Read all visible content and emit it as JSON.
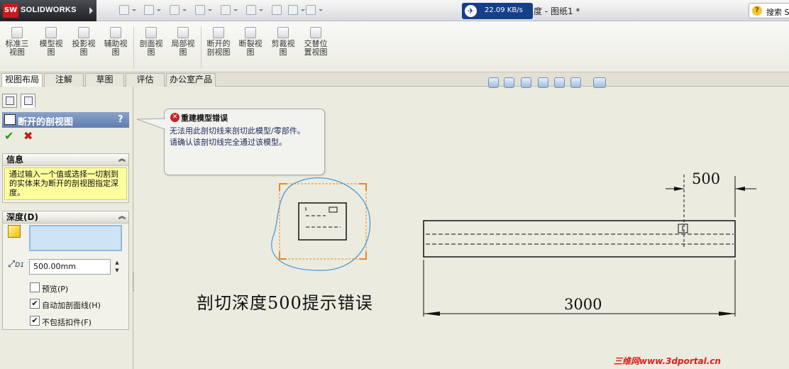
{
  "titlebar": {
    "brand": "SOLIDWORKS",
    "logo_mark": "SW",
    "net_speed": "22.09 KB/s",
    "document_title": "度 - 图纸1 *",
    "search_label": "搜索 S"
  },
  "ribbon": {
    "buttons": [
      {
        "label": "标准三\n视图",
        "icon": "standard-three-view-icon"
      },
      {
        "label": "模型视\n图",
        "icon": "model-view-icon"
      },
      {
        "label": "投影视\n图",
        "icon": "projected-view-icon"
      },
      {
        "label": "辅助视\n图",
        "icon": "auxiliary-view-icon"
      },
      {
        "label": "剖面视\n图",
        "icon": "section-view-icon"
      },
      {
        "label": "局部视\n图",
        "icon": "detail-view-icon"
      },
      {
        "label": "断开的\n剖视图",
        "icon": "broken-out-section-icon"
      },
      {
        "label": "断裂视\n图",
        "icon": "break-view-icon"
      },
      {
        "label": "剪裁视\n图",
        "icon": "crop-view-icon"
      },
      {
        "label": "交替位\n置视图",
        "icon": "alternate-position-view-icon"
      }
    ]
  },
  "tabs": [
    "视图布局",
    "注解",
    "草图",
    "评估",
    "办公室产品"
  ],
  "panel": {
    "title": "断开的剖视图",
    "help": "?",
    "info_header": "信息",
    "info_text": "通过输入一个值或选择一切割到的实体来为断开的剖视图指定深度。",
    "depth_header": "深度(D)",
    "depth_value": "500.00mm",
    "dim_icon_label": "D1",
    "options": [
      {
        "label": "预览(P)",
        "checked": false
      },
      {
        "label": "自动加剖面线(H)",
        "checked": true
      },
      {
        "label": "不包括扣件(F)",
        "checked": true
      }
    ]
  },
  "callout": {
    "title": "重建模型错误",
    "message": "无法用此剖切线来剖切此模型/零部件。\n请确认该剖切线完全通过该模型。"
  },
  "drawing": {
    "dimension_depth": "500",
    "dimension_length": "3000",
    "caption": "剖切深度500提示错误",
    "watermark": "三维网www.3dportal.cn"
  },
  "colors": {
    "accent_header": "#6f8cbf",
    "info_bg": "#fdfe9c",
    "error": "#c92222",
    "sketch_blue": "#4a9ad8",
    "frame_orange": "#e8891a"
  }
}
